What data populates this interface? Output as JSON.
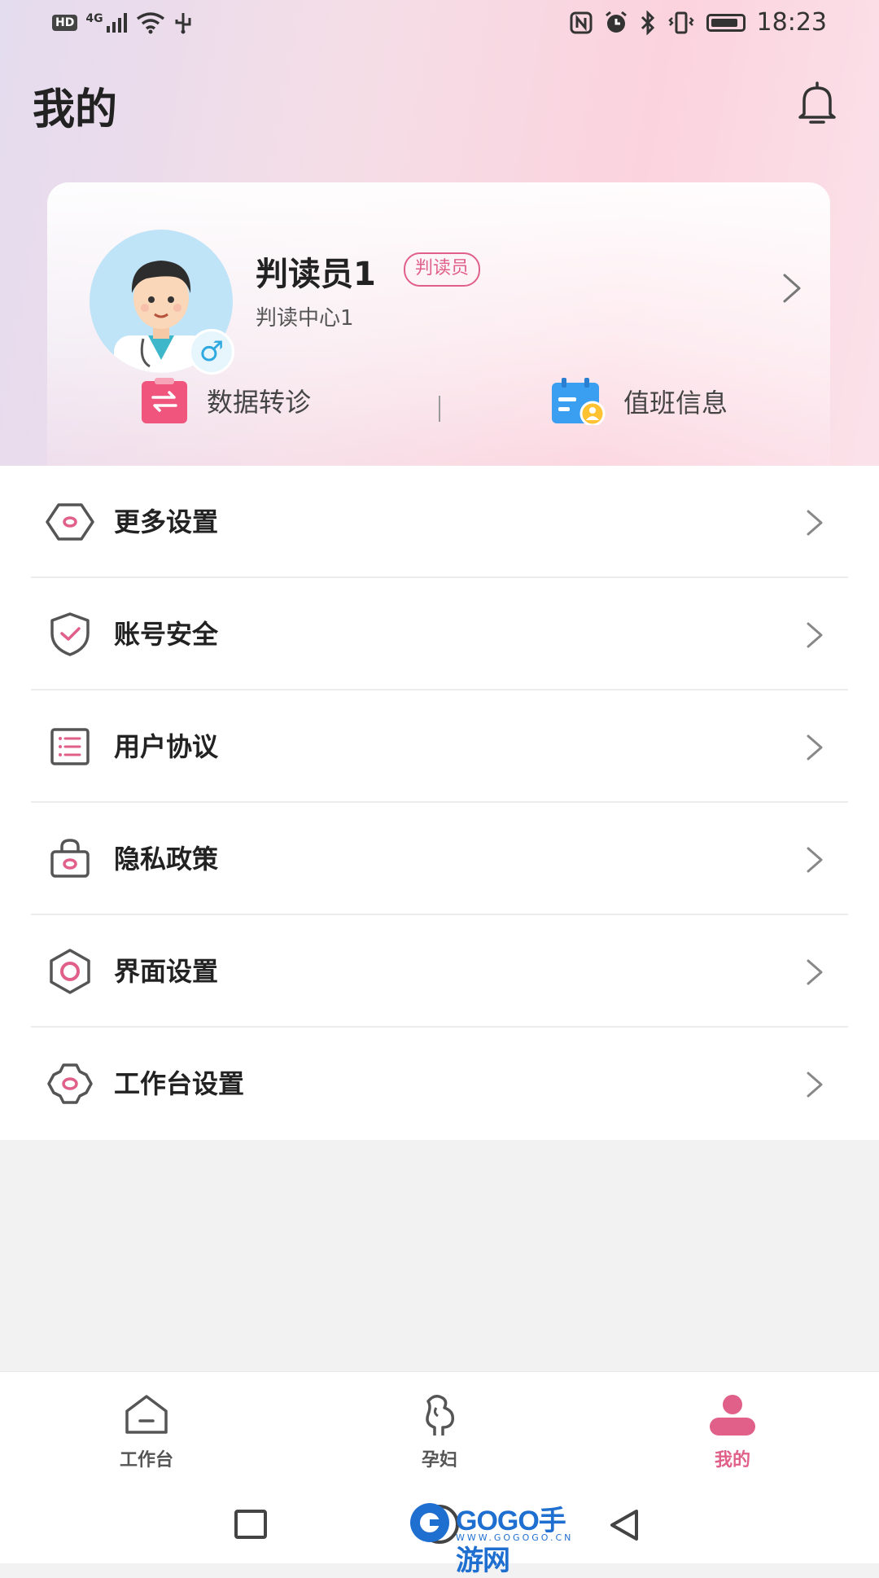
{
  "status_bar": {
    "hd": "HD",
    "network": "4G",
    "time": "18:23"
  },
  "header": {
    "title": "我的",
    "notification_icon": "bell-icon"
  },
  "profile": {
    "name": "判读员1",
    "role_badge": "判读员",
    "organization": "判读中心1",
    "gender_symbol": "♂",
    "avatar_icon": "doctor-avatar",
    "quick_actions": [
      {
        "label": "数据转诊",
        "icon": "transfer-icon",
        "color": "#f0557d"
      },
      {
        "label": "值班信息",
        "icon": "calendar-user-icon",
        "color": "#3a9ff0"
      }
    ]
  },
  "menu": {
    "items": [
      {
        "label": "更多设置",
        "icon": "hexagon-settings-icon"
      },
      {
        "label": "账号安全",
        "icon": "shield-check-icon"
      },
      {
        "label": "用户协议",
        "icon": "list-document-icon"
      },
      {
        "label": "隐私政策",
        "icon": "lock-bag-icon"
      },
      {
        "label": "界面设置",
        "icon": "hexagon-ring-icon"
      },
      {
        "label": "工作台设置",
        "icon": "gear-icon"
      }
    ]
  },
  "bottom_nav": {
    "items": [
      {
        "label": "工作台",
        "icon": "home-icon",
        "active": false
      },
      {
        "label": "孕妇",
        "icon": "pregnant-icon",
        "active": false
      },
      {
        "label": "我的",
        "icon": "user-icon",
        "active": true
      }
    ]
  },
  "watermark": {
    "text": "GOGO手游网",
    "sub": "WWW.GOGOGO.CN"
  },
  "colors": {
    "accent": "#e0608a",
    "icon_outline": "#555555"
  }
}
